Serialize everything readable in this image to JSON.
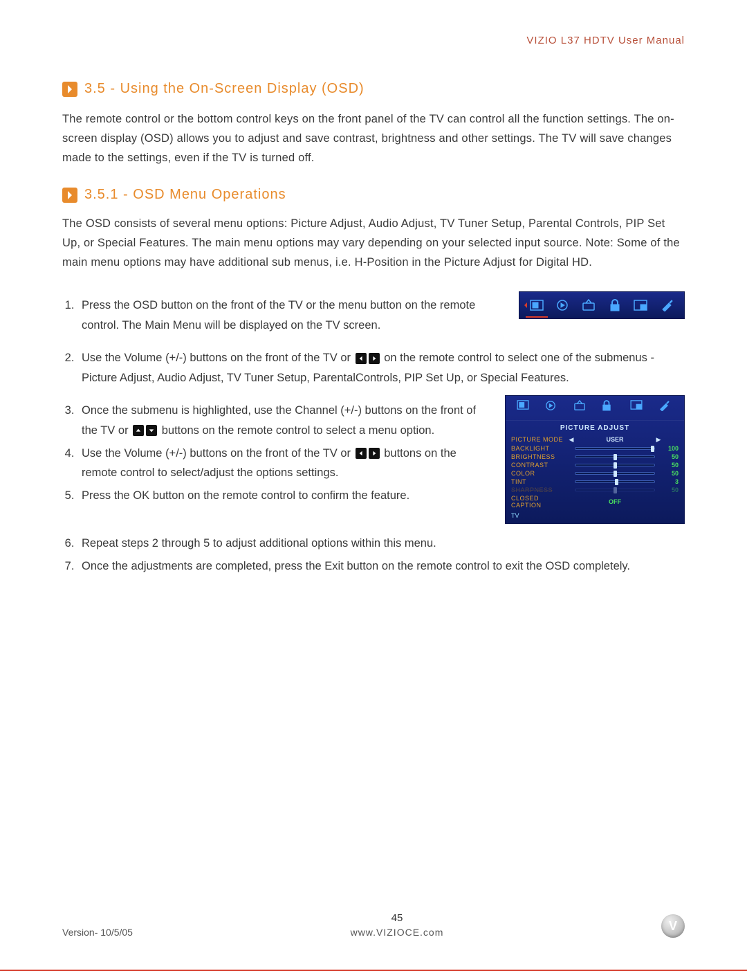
{
  "header": {
    "manual_title": "VIZIO L37 HDTV User Manual"
  },
  "section_35": {
    "number_title": "3.5 - Using the On-Screen Display (OSD)",
    "intro": "The remote control or the bottom control keys on the front panel of the TV can control all the function settings.  The on-screen display (OSD) allows you to adjust and save contrast, brightness and other settings.  The TV will save changes made to the settings, even if the TV is turned off."
  },
  "section_351": {
    "number_title": "3.5.1 - OSD Menu Operations",
    "intro": "The OSD consists of several menu options:  Picture Adjust, Audio Adjust, TV Tuner Setup, Parental Controls, PIP Set Up, or Special Features.  The main menu options may vary depending on your selected input source.  Note: Some of the main menu options may have additional sub menus, i.e. H-Position in the Picture Adjust for Digital HD.",
    "steps": {
      "s1": "Press the OSD button on the front of the TV or the menu button on the remote control.  The Main Menu will be displayed on the TV screen.",
      "s2a": "Use the Volume (+/-) buttons on the front of the TV or ",
      "s2b": " on the remote control to select one of the submenus - Picture Adjust, Audio Adjust, TV Tuner Setup, ParentalControls, PIP Set Up, or Special Features.",
      "s3a": "Once the submenu is highlighted, use the Channel (+/-) buttons on the front of the TV or ",
      "s3b": " buttons on the remote control to select a menu option.",
      "s4a": "Use the Volume (+/-) buttons on the front of the TV or ",
      "s4b": " buttons on the remote control to select/adjust the options settings.",
      "s5": "Press the OK button on the remote control to confirm the feature.",
      "s6": "Repeat steps 2 through 5 to adjust additional options within this menu.",
      "s7": "Once the adjustments are completed, press the Exit button on the remote control to exit the OSD completely."
    }
  },
  "osd_panel": {
    "title": "PICTURE ADJUST",
    "rows": [
      {
        "label": "PICTURE MODE",
        "mode": "USER"
      },
      {
        "label": "BACKLIGHT",
        "value": "100",
        "pct": 100
      },
      {
        "label": "BRIGHTNESS",
        "value": "50",
        "pct": 50
      },
      {
        "label": "CONTRAST",
        "value": "50",
        "pct": 50
      },
      {
        "label": "COLOR",
        "value": "50",
        "pct": 50
      },
      {
        "label": "TINT",
        "value": "3",
        "pct": 52
      },
      {
        "label": "SHARPNESS",
        "value": "50",
        "dim": true
      },
      {
        "label": "CLOSED CAPTION",
        "mode": "OFF"
      }
    ],
    "status": "TV"
  },
  "footer": {
    "version": "Version- 10/5/05",
    "page": "45",
    "url": "www.VIZIOCE.com",
    "logo_letter": "V"
  }
}
